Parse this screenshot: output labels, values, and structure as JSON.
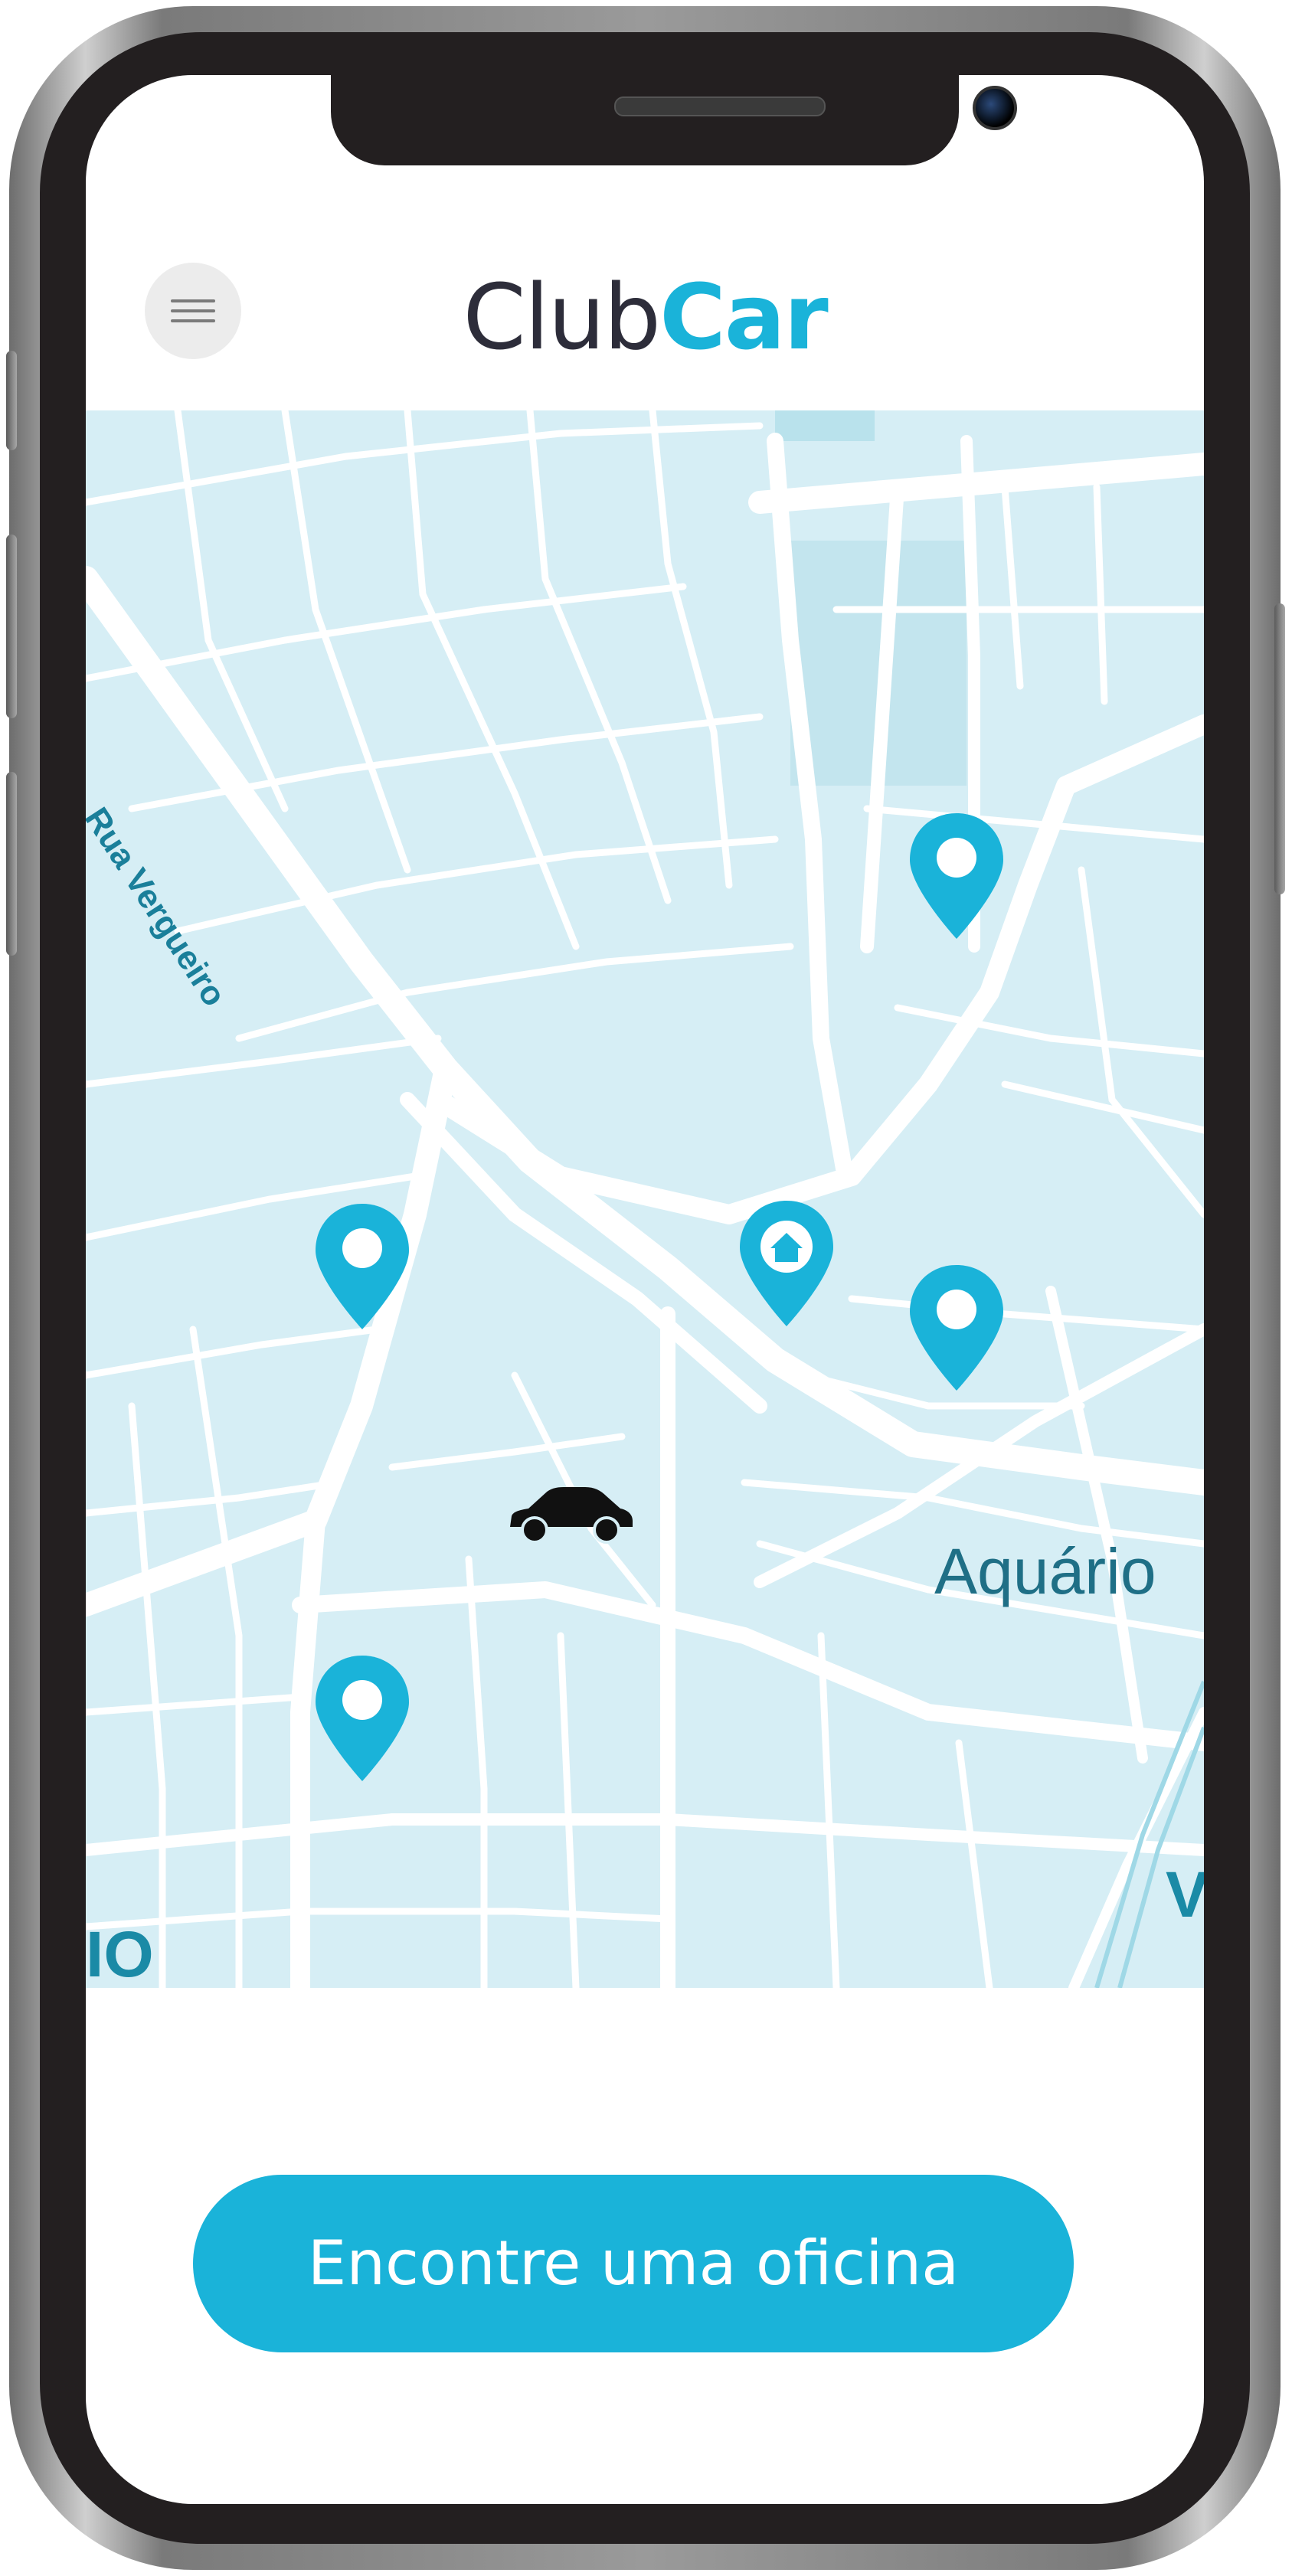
{
  "header": {
    "menu_icon": "hamburger-menu-icon",
    "logo_part1": "Club",
    "logo_part2": "Car",
    "logo_colors": {
      "part1": "#2d2d3a",
      "part2": "#1ab3d9"
    }
  },
  "map": {
    "street_label": "Rua Vergueiro",
    "district_label": "Aquário",
    "edge_label_left": "IO",
    "edge_label_right": "V",
    "pins": [
      {
        "icon": "location-pin-icon"
      },
      {
        "icon": "location-pin-icon"
      },
      {
        "icon": "home-pin-icon"
      },
      {
        "icon": "location-pin-icon"
      },
      {
        "icon": "location-pin-icon"
      }
    ],
    "vehicle_icon": "car-icon",
    "colors": {
      "water": "#d6eef5",
      "roads": "#ffffff",
      "pin": "#1ab3d9",
      "label": "#1f6f86"
    }
  },
  "cta": {
    "label": "Encontre uma oficina",
    "color": "#1ab3d9"
  }
}
